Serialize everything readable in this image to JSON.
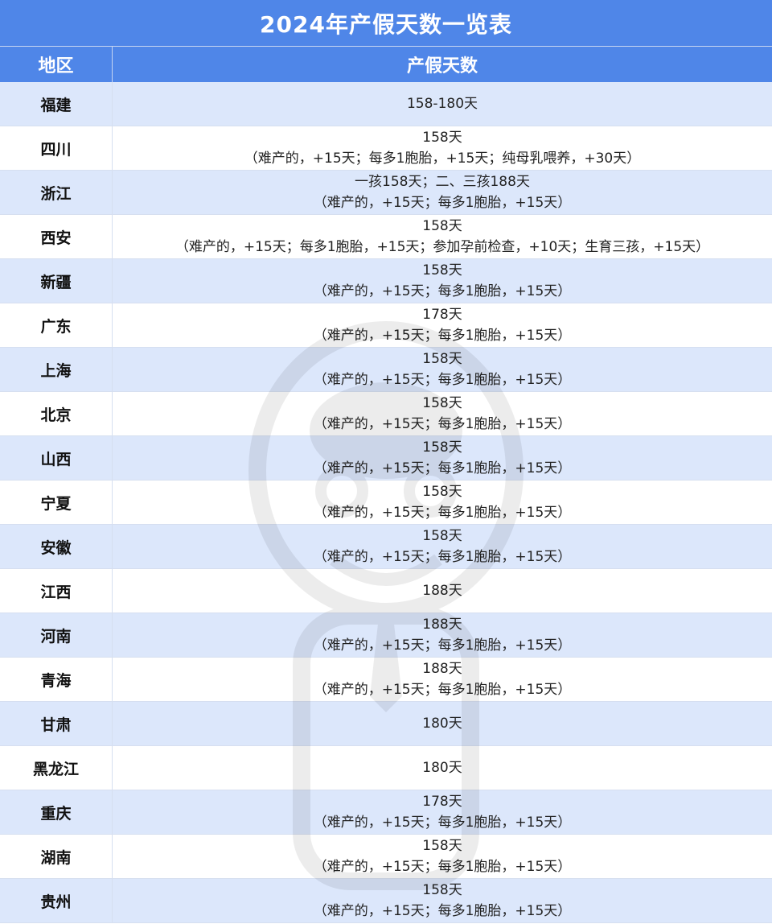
{
  "title": "2024年产假天数一览表",
  "header": {
    "region": "地区",
    "days": "产假天数"
  },
  "rows": [
    {
      "region": "福建",
      "line1": "158-180天",
      "line2": ""
    },
    {
      "region": "四川",
      "line1": "158天",
      "line2": "（难产的，+15天；每多1胞胎，+15天；纯母乳喂养，+30天）"
    },
    {
      "region": "浙江",
      "line1": "一孩158天；二、三孩188天",
      "line2": "（难产的，+15天；每多1胞胎，+15天）"
    },
    {
      "region": "西安",
      "line1": "158天",
      "line2": "（难产的，+15天；每多1胞胎，+15天；参加孕前检查，+10天；生育三孩，+15天）"
    },
    {
      "region": "新疆",
      "line1": "158天",
      "line2": "（难产的，+15天；每多1胞胎，+15天）"
    },
    {
      "region": "广东",
      "line1": "178天",
      "line2": "（难产的，+15天；每多1胞胎，+15天）"
    },
    {
      "region": "上海",
      "line1": "158天",
      "line2": "（难产的，+15天；每多1胞胎，+15天）"
    },
    {
      "region": "北京",
      "line1": "158天",
      "line2": "（难产的，+15天；每多1胞胎，+15天）"
    },
    {
      "region": "山西",
      "line1": "158天",
      "line2": "（难产的，+15天；每多1胞胎，+15天）"
    },
    {
      "region": "宁夏",
      "line1": "158天",
      "line2": "（难产的，+15天；每多1胞胎，+15天）"
    },
    {
      "region": "安徽",
      "line1": "158天",
      "line2": "（难产的，+15天；每多1胞胎，+15天）"
    },
    {
      "region": "江西",
      "line1": "188天",
      "line2": ""
    },
    {
      "region": "河南",
      "line1": "188天",
      "line2": "（难产的，+15天；每多1胞胎，+15天）"
    },
    {
      "region": "青海",
      "line1": "188天",
      "line2": "（难产的，+15天；每多1胞胎，+15天）"
    },
    {
      "region": "甘肃",
      "line1": "180天",
      "line2": ""
    },
    {
      "region": "黑龙江",
      "line1": "180天",
      "line2": ""
    },
    {
      "region": "重庆",
      "line1": "178天",
      "line2": "（难产的，+15天；每多1胞胎，+15天）"
    },
    {
      "region": "湖南",
      "line1": "158天",
      "line2": "（难产的，+15天；每多1胞胎，+15天）"
    },
    {
      "region": "贵州",
      "line1": "158天",
      "line2": "（难产的，+15天；每多1胞胎，+15天）"
    }
  ],
  "colors": {
    "header_bg": "#4f86e8",
    "alt_row_bg": "#dce7fb",
    "text": "#222222"
  },
  "watermark_icon": "cartoon-mascot-icon"
}
